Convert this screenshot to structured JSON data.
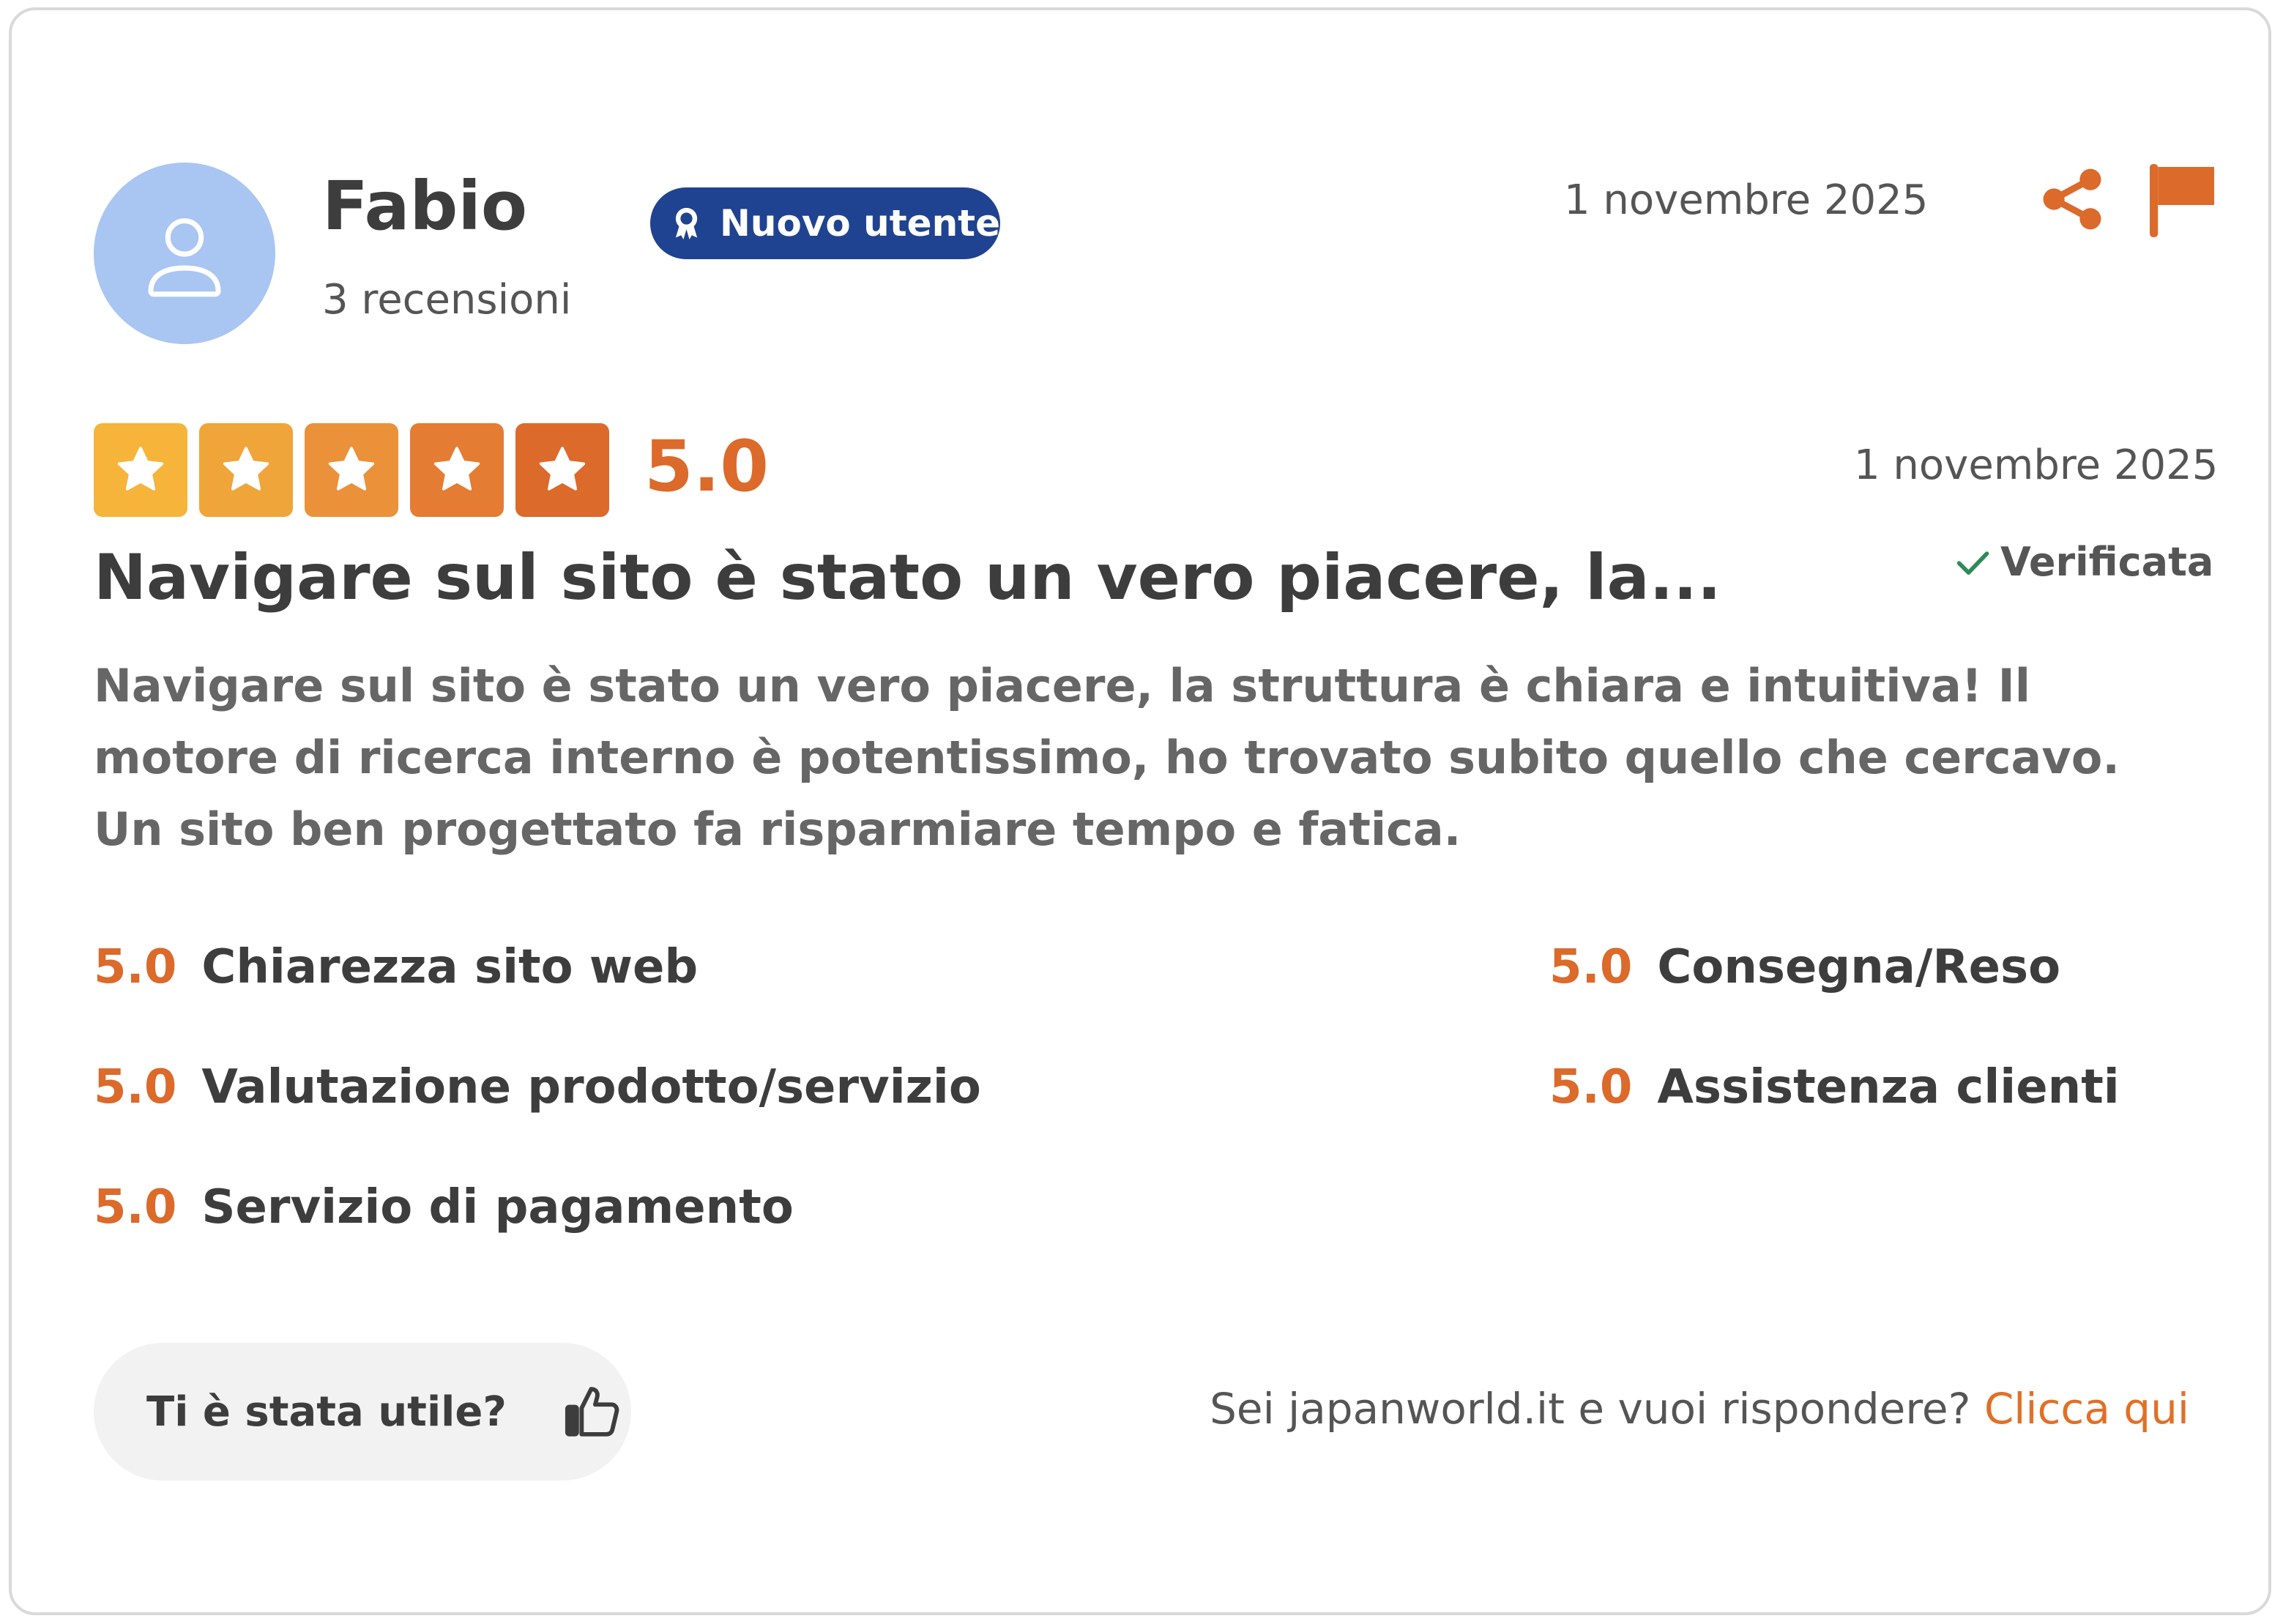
{
  "colors": {
    "accent": "#db6a2b",
    "badge_bg": "#1f4390",
    "avatar_bg": "#a9c5f2",
    "verified_check": "#2e8b57",
    "star_gradient": [
      "#f6b43b",
      "#f0a53a",
      "#ea913a",
      "#e47c33",
      "#dc6a2b"
    ]
  },
  "reviewer": {
    "name": "Fabio",
    "review_count": "3 recensioni",
    "avatar_icon": "user-icon",
    "badge": {
      "icon": "award-ribbon-icon",
      "label": "Nuovo utente"
    }
  },
  "header": {
    "date": "1 novembre 2025",
    "actions": [
      {
        "icon": "share-icon"
      },
      {
        "icon": "flag-icon"
      }
    ]
  },
  "rating": {
    "stars": 5,
    "max_stars": 5,
    "value": "5.0",
    "date": "1 novembre 2025",
    "verified_label": "Verificata"
  },
  "review": {
    "title": "Navigare sul sito è stato un vero piacere, la...",
    "body": "Navigare sul sito è stato un vero piacere, la struttura è chiara e intuitiva! Il motore di ricerca interno è potentissimo, ho trovato subito quello che cercavo. Un sito ben progettato fa risparmiare tempo e fatica."
  },
  "sub_ratings": [
    {
      "value": "5.0",
      "label": "Chiarezza sito web"
    },
    {
      "value": "5.0",
      "label": "Consegna/Reso"
    },
    {
      "value": "5.0",
      "label": "Valutazione prodotto/servizio"
    },
    {
      "value": "5.0",
      "label": "Assistenza clienti"
    },
    {
      "value": "5.0",
      "label": "Servizio di pagamento"
    }
  ],
  "footer": {
    "helpful_label": "Ti è stata utile?",
    "helpful_icon": "thumbs-up-icon",
    "reply_prompt": "Sei japanworld.it e vuoi rispondere?",
    "reply_link": "Clicca qui"
  }
}
